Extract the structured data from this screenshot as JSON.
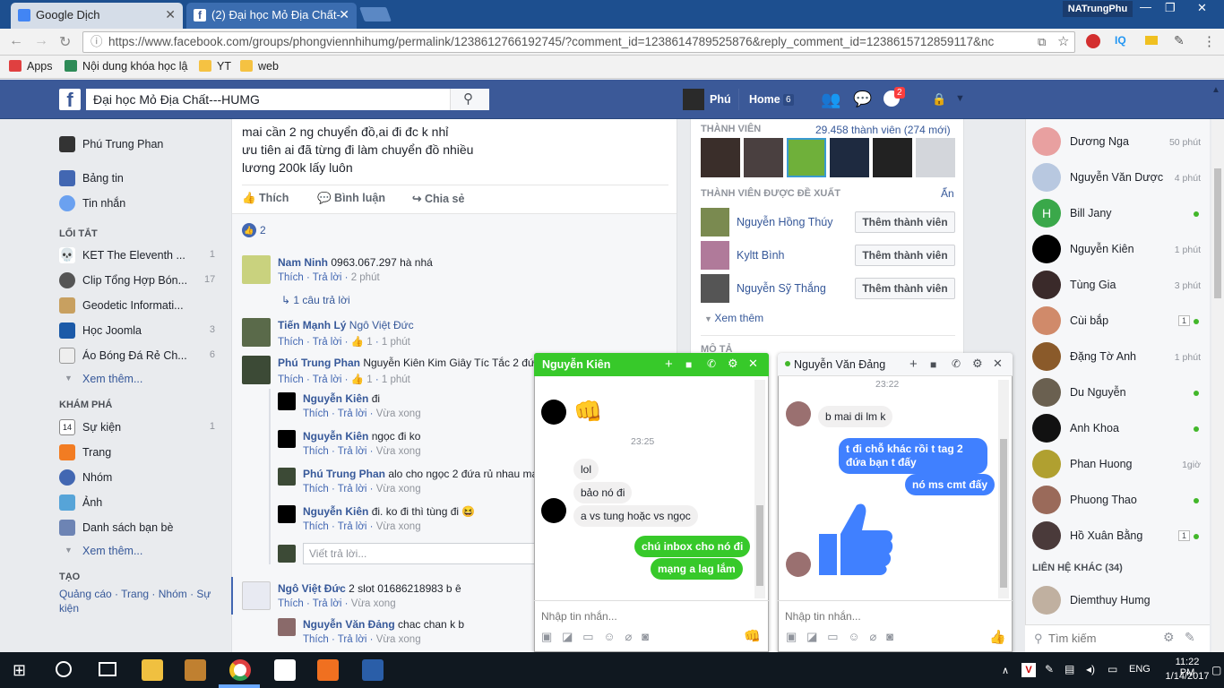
{
  "browser": {
    "tabs": [
      {
        "label": "Google Dịch"
      },
      {
        "label": "(2) Đại học Mỏ Địa Chất-"
      }
    ],
    "profile": "NATrungPhu",
    "url": "https://www.facebook.com/groups/phongviennhihumg/permalink/1238612766192745/?comment_id=1238614789525876&reply_comment_id=1238615712859117&nc",
    "bookmarks": [
      "Apps",
      "Nội dung khóa học lậ",
      "YT",
      "web"
    ],
    "ext_iq": "IQ"
  },
  "fb": {
    "search_value": "Đại học Mỏ Địa Chất---HUMG",
    "user": "Phú",
    "home_label": "Home",
    "home_count": "6",
    "notif_count": "2"
  },
  "left": {
    "profile": "Phú Trung Phan",
    "top_items": [
      "Bảng tin",
      "Tin nhắn"
    ],
    "shortcuts_title": "LỐI TẮT",
    "shortcuts": [
      {
        "label": "KET The Eleventh ...",
        "count": "1"
      },
      {
        "label": "Clip Tổng Hợp Bón...",
        "count": "17"
      },
      {
        "label": "Geodetic Informati...",
        "count": ""
      },
      {
        "label": "Học Joomla",
        "count": "3"
      },
      {
        "label": "Áo Bóng Đá Rẻ Ch...",
        "count": "6"
      }
    ],
    "see_more": "Xem thêm...",
    "explore_title": "KHÁM PHÁ",
    "explore": [
      {
        "label": "Sự kiện",
        "count": "1"
      },
      {
        "label": "Trang",
        "count": ""
      },
      {
        "label": "Nhóm",
        "count": ""
      },
      {
        "label": "Ảnh",
        "count": ""
      },
      {
        "label": "Danh sách bạn bè",
        "count": ""
      }
    ],
    "see_more2": "Xem thêm...",
    "create_title": "TẠO",
    "create_links": "Quảng cáo · Trang · Nhóm · Sự kiện"
  },
  "post": {
    "lines": [
      "mai cần 2 ng chuyển đồ,ai đi đc k nhỉ",
      "ưu tiên ai đã từng đi làm chuyển đồ nhiều",
      "lương 200k lấy luôn"
    ],
    "actions": [
      "Thích",
      "Bình luận",
      "Chia sẻ"
    ],
    "likes": "2",
    "comments": [
      {
        "name": "Nam Ninh",
        "text": "0963.067.297 hà nhá",
        "meta": [
          "Thích",
          "Trả lời",
          "2 phút"
        ]
      },
      {
        "name": "",
        "text": "1 câu trả lời",
        "meta": []
      },
      {
        "name": "Tiến Mạnh Lý",
        "text": "Ngô Việt Đức",
        "meta": [
          "Thích",
          "Trả lời",
          "1",
          "1 phút"
        ]
      },
      {
        "name": "Phú Trung Phan",
        "text": "Nguyễn Kiên Kim Giây Tíc Tắc 2 đứ",
        "meta": [
          "Thích",
          "Trả lời",
          "1",
          "1 phút"
        ]
      },
      {
        "name": "Nguyễn Kiên",
        "text": "đi",
        "meta": [
          "Thích",
          "Trả lời",
          "Vừa xong"
        ]
      },
      {
        "name": "Nguyễn Kiên",
        "text": "ngọc đi ko",
        "meta": [
          "Thích",
          "Trả lời",
          "Vừa xong"
        ]
      },
      {
        "name": "Phú Trung Phan",
        "text": "alo cho ngọc 2 đứa rủ nhau ma",
        "meta": [
          "Thích",
          "Trả lời",
          "Vừa xong"
        ]
      },
      {
        "name": "Nguyễn Kiên",
        "text": "đi. ko đi thì tùng đi 😆",
        "meta": [
          "Thích",
          "Trả lời",
          "Vừa xong"
        ]
      },
      {
        "name": "",
        "text": "Viết trả lời...",
        "meta": []
      },
      {
        "name": "Ngô Việt Đức",
        "text": "2 slot 01686218983 b ê",
        "meta": [
          "Thích",
          "Trả lời",
          "Vừa xong"
        ]
      },
      {
        "name": "Nguyễn Văn Đảng",
        "text": "chac chan k b",
        "meta": [
          "Thích",
          "Trả lời",
          "Vừa xong"
        ]
      }
    ]
  },
  "right": {
    "members_title": "THÀNH VIÊN",
    "members_count": "29.458 thành viên (274 mới)",
    "suggest_title": "THÀNH VIÊN ĐƯỢC ĐỀ XUẤT",
    "hide": "Ẩn",
    "suggest": [
      {
        "name": "Nguyễn Hồng Thúy"
      },
      {
        "name": "Kyltt Bình"
      },
      {
        "name": "Nguyễn Sỹ Thắng"
      }
    ],
    "add_label": "Thêm thành viên",
    "see_more": "Xem thêm",
    "desc_title": "MÔ TẢ"
  },
  "chat": {
    "contacts": [
      {
        "name": "Dương Nga",
        "status": "50 phút",
        "online": false
      },
      {
        "name": "Nguyễn Văn Dược",
        "status": "4 phút",
        "online": false
      },
      {
        "name": "Bill Jany",
        "status": "",
        "online": true
      },
      {
        "name": "Nguyễn Kiên",
        "status": "1 phút",
        "online": false
      },
      {
        "name": "Tùng Gia",
        "status": "3 phút",
        "online": false
      },
      {
        "name": "Cùi bắp",
        "status": "1",
        "online": true
      },
      {
        "name": "Đặng Tờ Anh",
        "status": "1 phút",
        "online": false
      },
      {
        "name": "Du Nguyễn",
        "status": "",
        "online": true
      },
      {
        "name": "Anh Khoa",
        "status": "",
        "online": true
      },
      {
        "name": "Phan Huong",
        "status": "1giờ",
        "online": false
      },
      {
        "name": "Phuong Thao",
        "status": "",
        "online": true
      },
      {
        "name": "Hồ Xuân Bằng",
        "status": "1",
        "online": true
      }
    ],
    "other_title": "LIÊN HỆ KHÁC (34)",
    "other": [
      {
        "name": "Diemthuy Humg"
      }
    ],
    "search_placeholder": "Tìm kiếm",
    "bill_initial": "H"
  },
  "cw1": {
    "title": "Nguyễn Kiên",
    "time": "23:25",
    "left_msgs": [
      "lol",
      "bảo nó đi",
      "a vs tung hoặc vs ngọc"
    ],
    "right_msgs": [
      "chú inbox cho nó đi",
      "mạng a lag  lắm"
    ],
    "placeholder": "Nhập tin nhắn...",
    "color": "#37c92a"
  },
  "cw2": {
    "title": "Nguyễn Văn Đảng",
    "time": "23:22",
    "left_msgs": [
      "b mai di lm k"
    ],
    "right_msgs": [
      "t đi chỗ khác rồi t tag 2 đứa bạn t đấy",
      "nó ms cmt đấy"
    ],
    "placeholder": "Nhập tin nhắn...",
    "color": "#4080ff"
  },
  "taskbar": {
    "lang": "ENG",
    "time": "11:22 PM",
    "date": "1/14/2017"
  }
}
